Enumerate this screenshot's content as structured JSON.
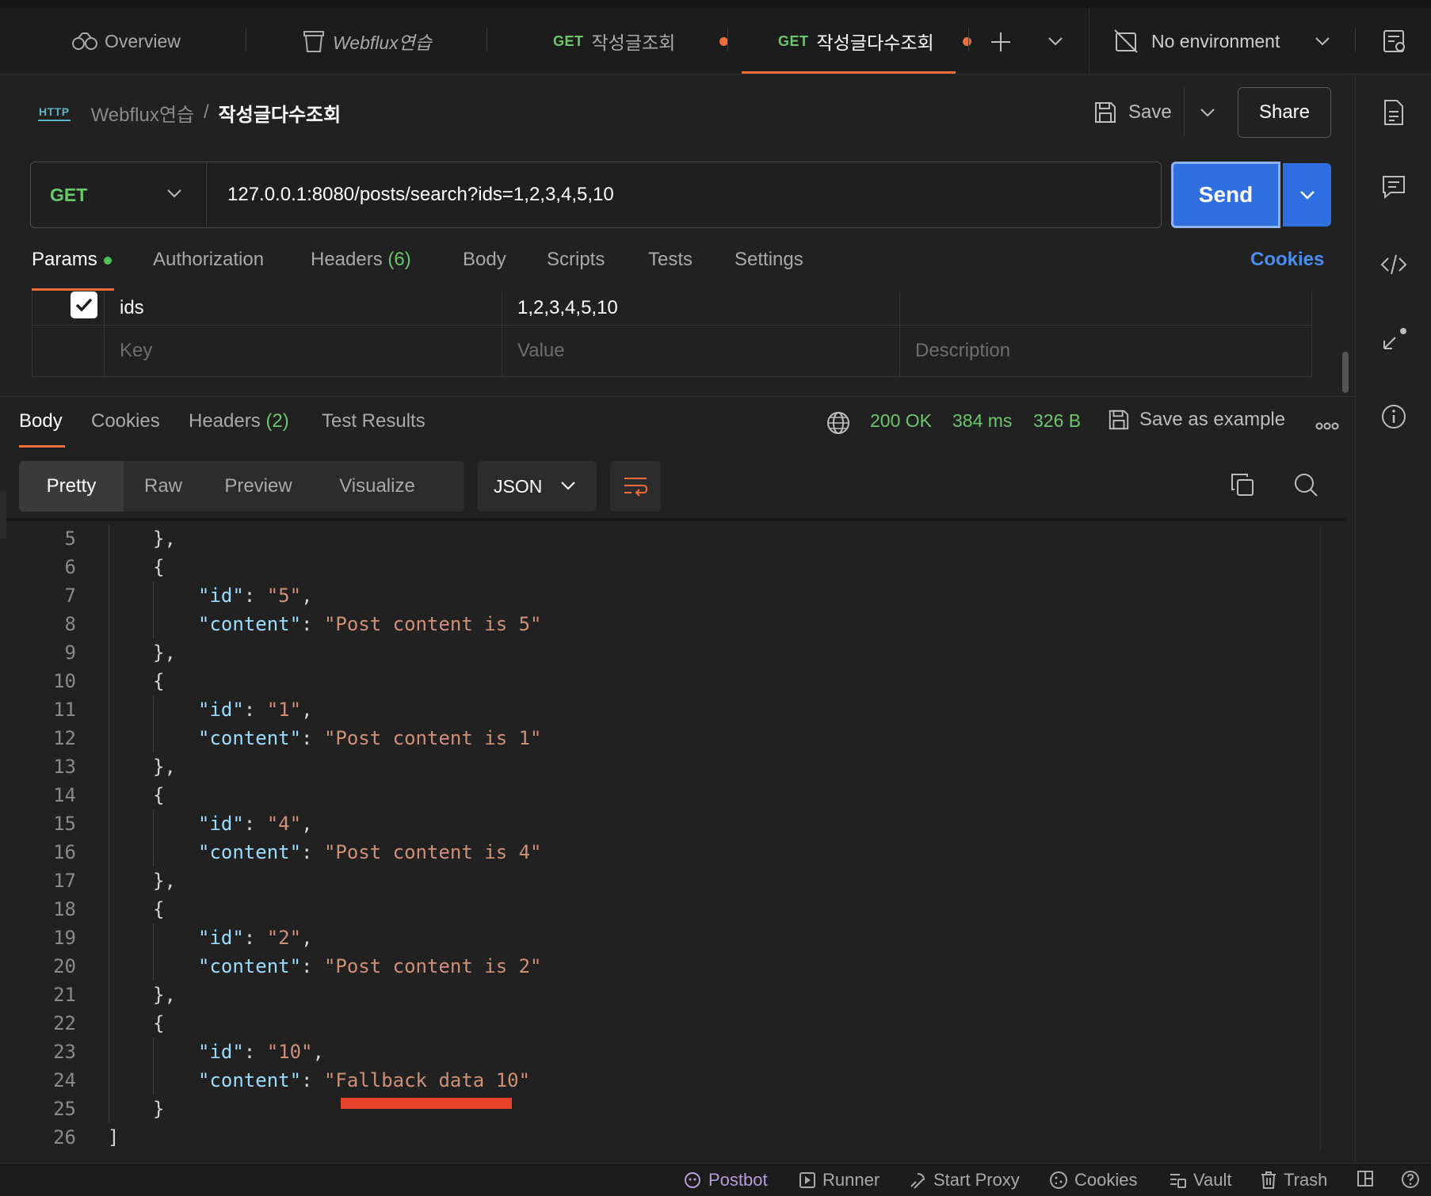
{
  "tabs": [
    {
      "label": "Overview"
    },
    {
      "label": "Webflux연습"
    },
    {
      "method": "GET",
      "label": "작성글조회"
    },
    {
      "method": "GET",
      "label": "작성글다수조회"
    }
  ],
  "environment": {
    "label": "No environment"
  },
  "breadcrumb": {
    "parent": "Webflux연습",
    "separator": "/",
    "current": "작성글다수조회",
    "badge": "HTTP"
  },
  "actions": {
    "save": "Save",
    "share": "Share"
  },
  "request": {
    "method": "GET",
    "url": "127.0.0.1:8080/posts/search?ids=1,2,3,4,5,10",
    "send": "Send"
  },
  "request_tabs": {
    "params": "Params",
    "authorization": "Authorization",
    "headers": "Headers",
    "headers_count": "(6)",
    "body": "Body",
    "scripts": "Scripts",
    "tests": "Tests",
    "settings": "Settings",
    "cookies": "Cookies"
  },
  "params": {
    "rows": [
      {
        "key": "ids",
        "value": "1,2,3,4,5,10",
        "checked": true
      }
    ],
    "placeholders": {
      "key": "Key",
      "value": "Value",
      "description": "Description"
    }
  },
  "response_tabs": {
    "body": "Body",
    "cookies": "Cookies",
    "headers": "Headers",
    "headers_count": "(2)",
    "test_results": "Test Results"
  },
  "response_status": {
    "status": "200 OK",
    "time": "384 ms",
    "size": "326 B",
    "save_example": "Save as example"
  },
  "view_modes": {
    "pretty": "Pretty",
    "raw": "Raw",
    "preview": "Preview",
    "visualize": "Visualize",
    "format": "JSON"
  },
  "code": {
    "lines": [
      {
        "n": "5",
        "ind": 1,
        "t": [
          [
            "p",
            "},"
          ]
        ]
      },
      {
        "n": "6",
        "ind": 1,
        "t": [
          [
            "p",
            "{"
          ]
        ]
      },
      {
        "n": "7",
        "ind": 2,
        "t": [
          [
            "k",
            "\"id\""
          ],
          [
            "p",
            ": "
          ],
          [
            "s",
            "\"5\""
          ],
          [
            "p",
            ","
          ]
        ]
      },
      {
        "n": "8",
        "ind": 2,
        "t": [
          [
            "k",
            "\"content\""
          ],
          [
            "p",
            ": "
          ],
          [
            "s",
            "\"Post content is 5\""
          ]
        ]
      },
      {
        "n": "9",
        "ind": 1,
        "t": [
          [
            "p",
            "},"
          ]
        ]
      },
      {
        "n": "10",
        "ind": 1,
        "t": [
          [
            "p",
            "{"
          ]
        ]
      },
      {
        "n": "11",
        "ind": 2,
        "t": [
          [
            "k",
            "\"id\""
          ],
          [
            "p",
            ": "
          ],
          [
            "s",
            "\"1\""
          ],
          [
            "p",
            ","
          ]
        ]
      },
      {
        "n": "12",
        "ind": 2,
        "t": [
          [
            "k",
            "\"content\""
          ],
          [
            "p",
            ": "
          ],
          [
            "s",
            "\"Post content is 1\""
          ]
        ]
      },
      {
        "n": "13",
        "ind": 1,
        "t": [
          [
            "p",
            "},"
          ]
        ]
      },
      {
        "n": "14",
        "ind": 1,
        "t": [
          [
            "p",
            "{"
          ]
        ]
      },
      {
        "n": "15",
        "ind": 2,
        "t": [
          [
            "k",
            "\"id\""
          ],
          [
            "p",
            ": "
          ],
          [
            "s",
            "\"4\""
          ],
          [
            "p",
            ","
          ]
        ]
      },
      {
        "n": "16",
        "ind": 2,
        "t": [
          [
            "k",
            "\"content\""
          ],
          [
            "p",
            ": "
          ],
          [
            "s",
            "\"Post content is 4\""
          ]
        ]
      },
      {
        "n": "17",
        "ind": 1,
        "t": [
          [
            "p",
            "},"
          ]
        ]
      },
      {
        "n": "18",
        "ind": 1,
        "t": [
          [
            "p",
            "{"
          ]
        ]
      },
      {
        "n": "19",
        "ind": 2,
        "t": [
          [
            "k",
            "\"id\""
          ],
          [
            "p",
            ": "
          ],
          [
            "s",
            "\"2\""
          ],
          [
            "p",
            ","
          ]
        ]
      },
      {
        "n": "20",
        "ind": 2,
        "t": [
          [
            "k",
            "\"content\""
          ],
          [
            "p",
            ": "
          ],
          [
            "s",
            "\"Post content is 2\""
          ]
        ]
      },
      {
        "n": "21",
        "ind": 1,
        "t": [
          [
            "p",
            "},"
          ]
        ]
      },
      {
        "n": "22",
        "ind": 1,
        "t": [
          [
            "p",
            "{"
          ]
        ]
      },
      {
        "n": "23",
        "ind": 2,
        "t": [
          [
            "k",
            "\"id\""
          ],
          [
            "p",
            ": "
          ],
          [
            "s",
            "\"10\""
          ],
          [
            "p",
            ","
          ]
        ]
      },
      {
        "n": "24",
        "ind": 2,
        "t": [
          [
            "k",
            "\"content\""
          ],
          [
            "p",
            ": "
          ],
          [
            "s",
            "\"Fallback data 10\""
          ]
        ]
      },
      {
        "n": "25",
        "ind": 1,
        "t": [
          [
            "p",
            "}"
          ]
        ]
      },
      {
        "n": "26",
        "ind": 0,
        "t": [
          [
            "p",
            "]"
          ]
        ]
      }
    ]
  },
  "statusbar": {
    "postbot": "Postbot",
    "runner": "Runner",
    "start_proxy": "Start Proxy",
    "cookies": "Cookies",
    "vault": "Vault",
    "trash": "Trash"
  },
  "colors": {
    "accent": "#f26b3a",
    "send": "#2f6fe0",
    "method": "#6cc76c",
    "link": "#4a8df0",
    "annotation": "#e8432d"
  },
  "icons": [
    "overview-icon",
    "collection-icon",
    "plus-icon",
    "chevron-down-icon",
    "no-environment-icon",
    "environment-quicklook-icon",
    "docs-icon",
    "comments-icon",
    "code-icon",
    "related-requests-icon",
    "info-icon",
    "save-icon",
    "checkbox-icon",
    "globe-icon",
    "wrap-lines-icon",
    "copy-icon",
    "search-icon",
    "postbot-icon",
    "runner-icon",
    "proxy-icon",
    "cookie-icon",
    "vault-icon",
    "trash-icon",
    "two-pane-icon",
    "help-icon"
  ]
}
